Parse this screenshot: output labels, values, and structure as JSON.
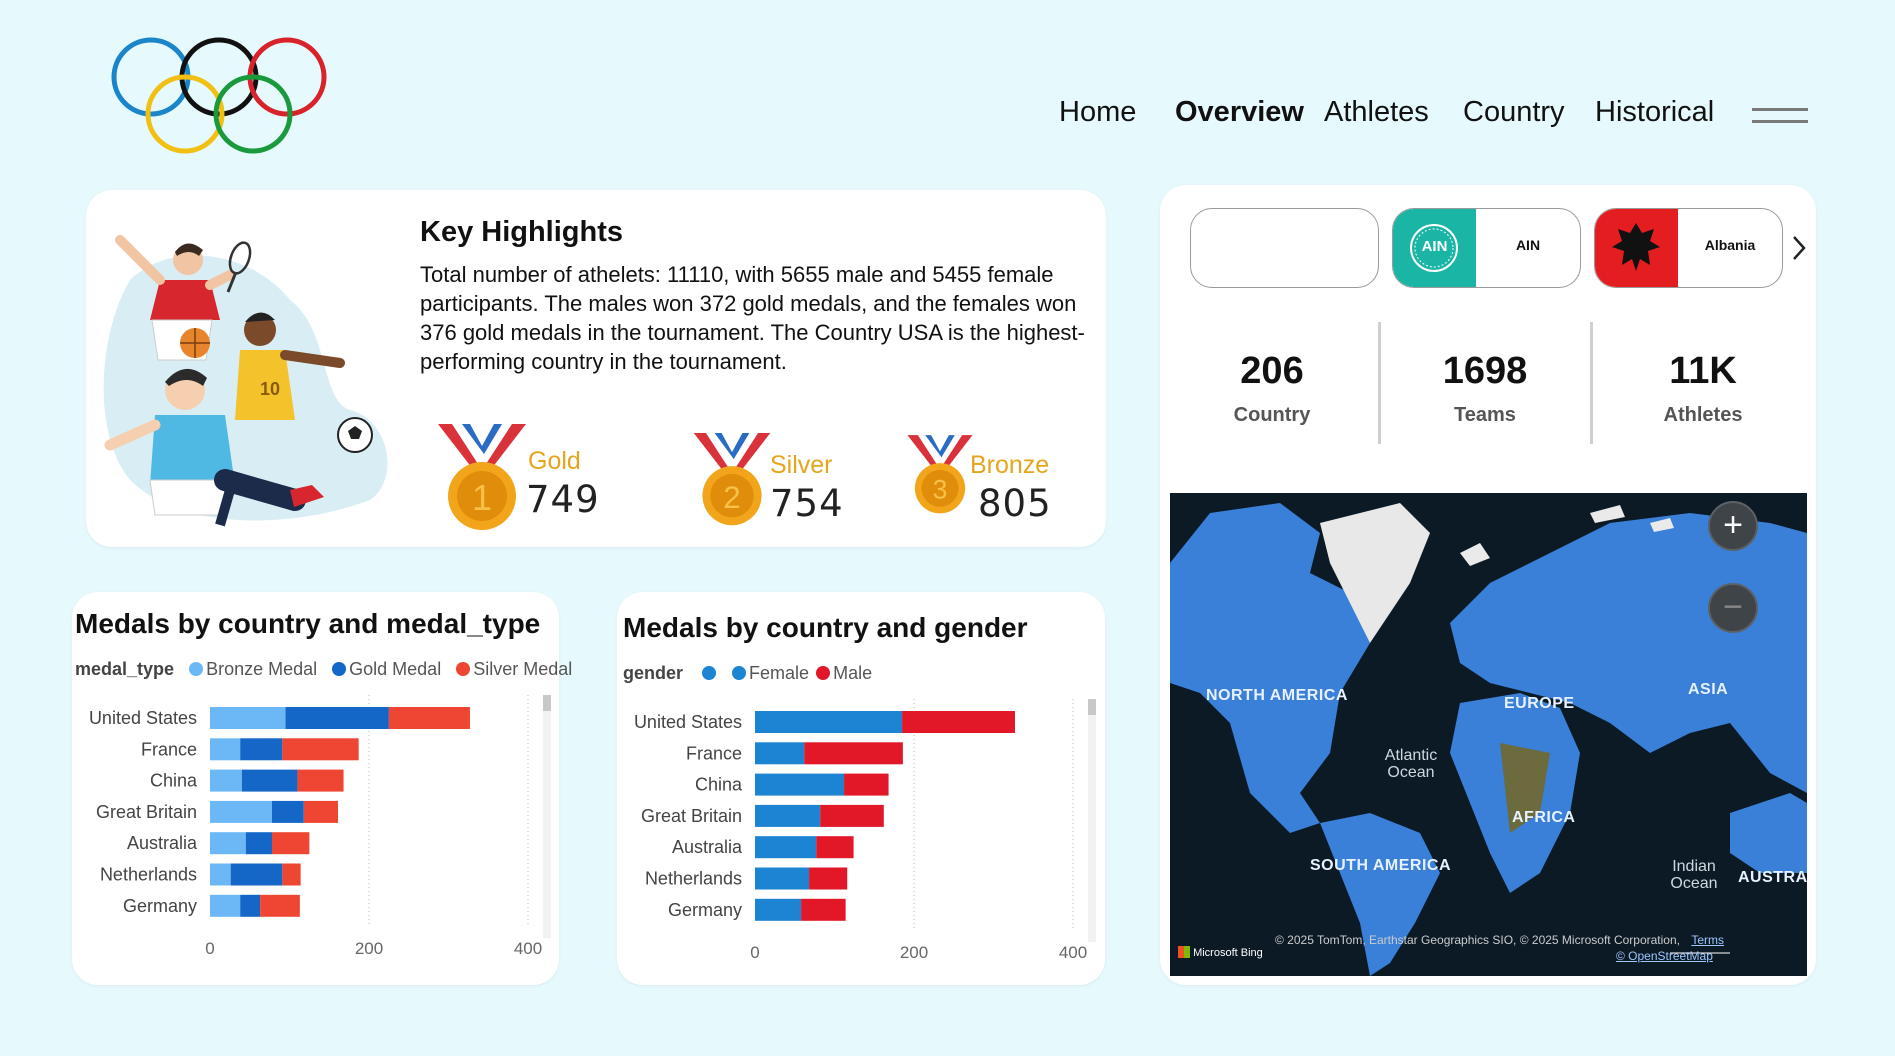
{
  "nav": {
    "home": "Home",
    "overview": "Overview",
    "athletes": "Athletes",
    "country": "Country",
    "historical": "Historical"
  },
  "highlights": {
    "title": "Key Highlights",
    "text": "Total number of athelets: 11110, with 5655 male and 5455 female participants. The males won 372 gold medals, and the females won 376 gold medals in the tournament. The Country USA is the highest-performing country in the tournament.",
    "medals": [
      {
        "label": "Gold",
        "value": "749",
        "rank": "1"
      },
      {
        "label": "Silver",
        "value": "754",
        "rank": "2"
      },
      {
        "label": "Bronze",
        "value": "805",
        "rank": "3"
      }
    ]
  },
  "chart1": {
    "title": "Medals by country and medal_type",
    "legend_title": "medal_type",
    "legend": [
      "Bronze Medal",
      "Gold Medal",
      "Silver Medal"
    ]
  },
  "chart2": {
    "title": "Medals by country and gender",
    "legend_title": "gender",
    "legend": [
      "",
      "Female",
      "Male"
    ]
  },
  "chart_data": [
    {
      "type": "bar",
      "orientation": "horizontal",
      "stacked": true,
      "title": "Medals by country and medal_type",
      "categories": [
        "United States",
        "France",
        "China",
        "Great Britain",
        "Australia",
        "Netherlands",
        "Germany"
      ],
      "series": [
        {
          "name": "Bronze Medal",
          "color": "#6cb8f6",
          "values": [
            95,
            38,
            40,
            78,
            45,
            26,
            38
          ]
        },
        {
          "name": "Gold Medal",
          "color": "#1467c6",
          "values": [
            130,
            53,
            70,
            40,
            33,
            65,
            25
          ]
        },
        {
          "name": "Silver Medal",
          "color": "#ee4632",
          "values": [
            102,
            96,
            58,
            43,
            47,
            23,
            50
          ]
        }
      ],
      "xticks": [
        "0",
        "200",
        "400"
      ],
      "xlim": [
        0,
        400
      ]
    },
    {
      "type": "bar",
      "orientation": "horizontal",
      "stacked": true,
      "title": "Medals by country and gender",
      "categories": [
        "United States",
        "France",
        "China",
        "Great Britain",
        "Australia",
        "Netherlands",
        "Germany"
      ],
      "series": [
        {
          "name": "Female",
          "color": "#1c84d2",
          "values": [
            185,
            62,
            112,
            82,
            77,
            68,
            58
          ]
        },
        {
          "name": "Male",
          "color": "#e21728",
          "values": [
            142,
            124,
            56,
            80,
            47,
            48,
            56
          ]
        }
      ],
      "xticks": [
        "0",
        "200",
        "400"
      ],
      "xlim": [
        0,
        400
      ]
    }
  ],
  "filters": {
    "cards": [
      {
        "label": ""
      },
      {
        "label": "AIN",
        "badge": "AIN",
        "color": "#1bb5a6"
      },
      {
        "label": "Albania",
        "color": "#e41e20"
      }
    ]
  },
  "kpis": [
    {
      "value": "206",
      "label": "Country"
    },
    {
      "value": "1698",
      "label": "Teams"
    },
    {
      "value": "11K",
      "label": "Athletes"
    }
  ],
  "map": {
    "labels": {
      "north_america": "NORTH AMERICA",
      "europe": "EUROPE",
      "asia": "ASIA",
      "africa": "AFRICA",
      "south_america": "SOUTH AMERICA",
      "australia": "AUSTRAL"
    },
    "oceans": {
      "atlantic_1": "Atlantic",
      "atlantic_2": "Ocean",
      "indian_1": "Indian",
      "indian_2": "Ocean"
    },
    "attribution": "© 2025 TomTom, Earthstar Geographics SIO, © 2025 Microsoft Corporation,",
    "terms": "Terms",
    "osm": "© OpenStreetMap",
    "bing": "Microsoft Bing"
  }
}
